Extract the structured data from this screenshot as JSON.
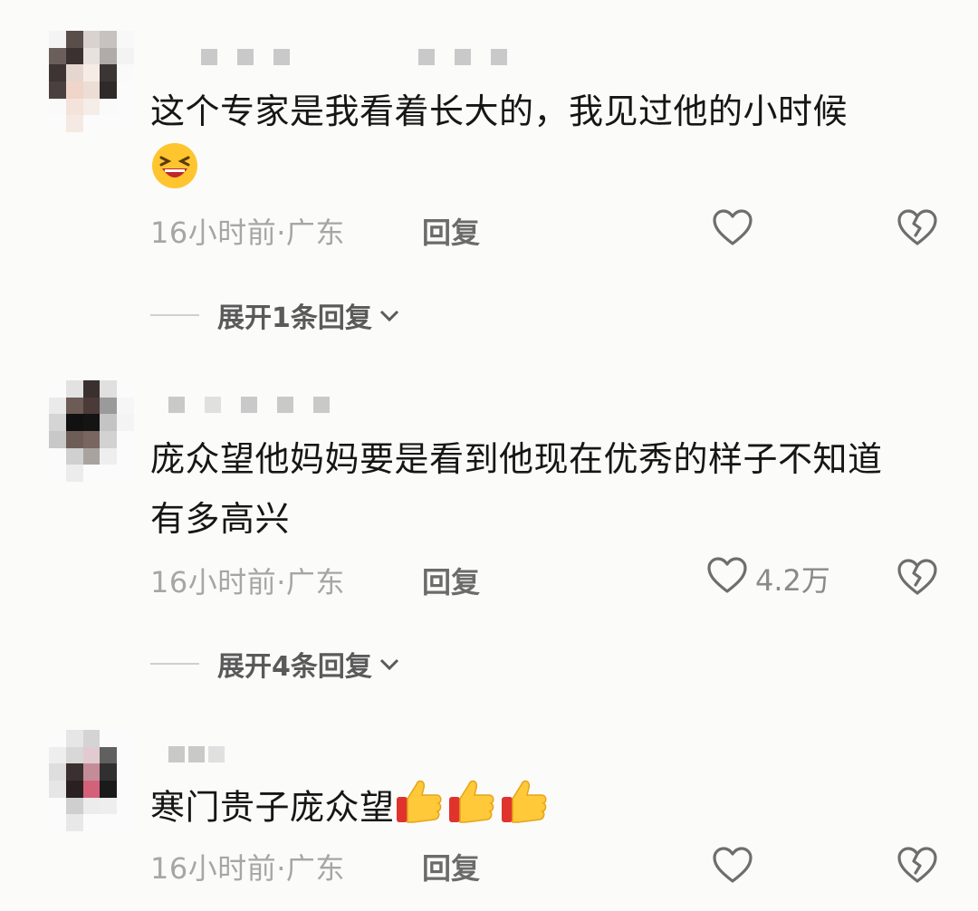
{
  "comments": [
    {
      "text": "这个专家是我看着长大的，我见过他的小时候",
      "emoji": "laughing-face-icon",
      "time": "16小时前",
      "location": "广东",
      "reply_label": "回复",
      "likes": "",
      "expand_label": "展开1条回复"
    },
    {
      "text": "庞众望他妈妈要是看到他现在优秀的样子不知道有多高兴",
      "time": "16小时前",
      "location": "广东",
      "reply_label": "回复",
      "likes": "4.2万",
      "expand_label": "展开4条回复"
    },
    {
      "text": "寒门贵子庞众望",
      "emoji": "thumbs-up-icon",
      "time": "16小时前",
      "location": "广东",
      "reply_label": "回复",
      "likes": ""
    }
  ],
  "meta_separator": "·",
  "colors": {
    "text": "#161616",
    "meta": "#a6a6a6",
    "reply": "#6b6b6b",
    "background": "#fbfbf9"
  }
}
